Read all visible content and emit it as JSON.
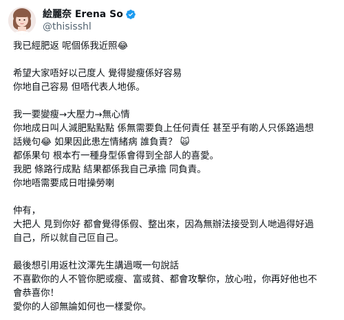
{
  "author": {
    "display_name": "絵麗奈 Erena So",
    "handle": "@thisisshl",
    "verified_icon": "verified-badge-icon",
    "avatar_icon": "profile-photo"
  },
  "colors": {
    "text": "#0f1419",
    "secondary": "#536471",
    "verified": "#1d9bf0"
  },
  "paragraphs": [
    {
      "lines": [
        "我已經肥返 呢個係我近照😂"
      ]
    },
    {
      "lines": [
        "希望大家唔好以己度人 覺得變瘦係好容易",
        "你地自己容易 但唔代表人地係。"
      ]
    },
    {
      "lines": [
        "我一要變瘦→大壓力→無心情",
        "你地成日叫人減肥點點點 係無需要負上任何責任 甚至乎有啲人只係路過想",
        "話幾句😂 如果因此患左情緒病 誰負責？ 🙀",
        "都係果句 根本冇一種身型係會得到全部人的喜愛。",
        "我肥 條路行成點 結果都係我自己承擔 同負責。",
        "你地唔需要成日咁操勞喇"
      ]
    },
    {
      "lines": [
        "仲有，",
        "大把人 見到你好 都會覺得係假、整出來，因為無辦法接受到人哋過得好過",
        "自己，所以就自己叵自己。"
      ]
    },
    {
      "lines": [
        "最後想引用返杜汶澤先生講過嘅一句說話",
        "不喜歡你的人不管你肥或瘦、富或貧、都會攻擊你，放心啦，你再好他也不",
        "會恭喜你！",
        "愛你的人卻無論如何也一樣愛你。"
      ]
    }
  ]
}
